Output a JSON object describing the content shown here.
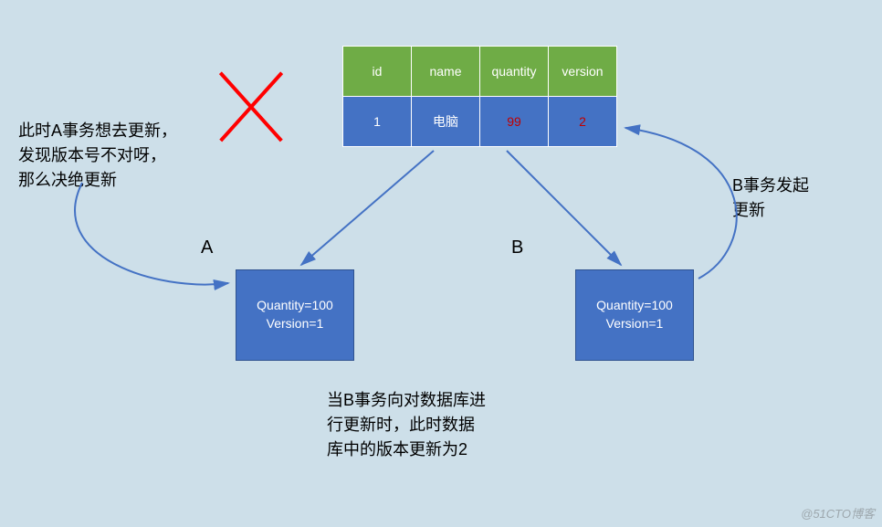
{
  "table": {
    "headers": {
      "c0": "id",
      "c1": "name",
      "c2": "quantity",
      "c3": "version"
    },
    "row": {
      "id": "1",
      "name": "电脑",
      "quantity": "99",
      "version": "2"
    }
  },
  "boxes": {
    "a": {
      "line1": "Quantity=100",
      "line2": "Version=1"
    },
    "b": {
      "line1": "Quantity=100",
      "line2": "Version=1"
    }
  },
  "labels": {
    "a": "A",
    "b": "B"
  },
  "texts": {
    "left": "此时A事务想去更新，\n发现版本号不对呀，\n那么决绝更新",
    "right": "B事务发起\n更新",
    "bottom": "当B事务向对数据库进\n行更新时，此时数据\n库中的版本更新为2"
  },
  "watermark": "@51CTO博客"
}
